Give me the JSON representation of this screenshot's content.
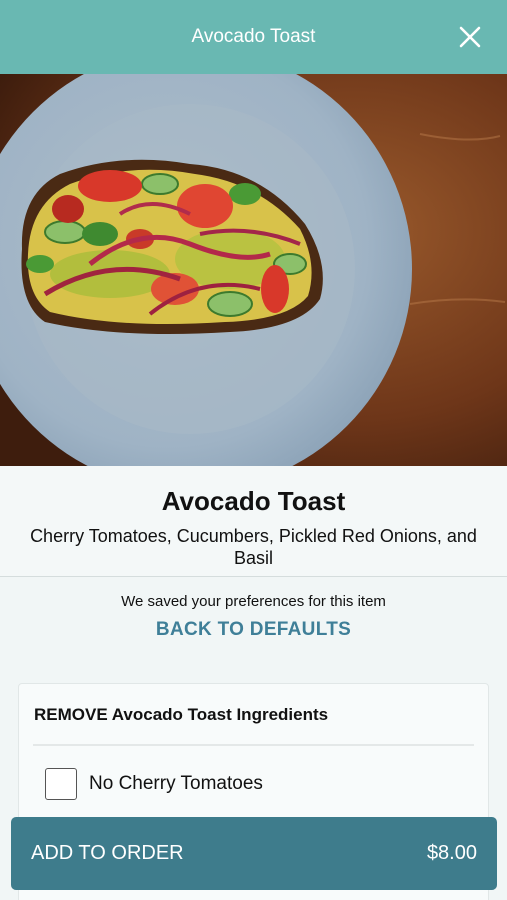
{
  "header": {
    "title": "Avocado Toast",
    "close_icon": "close-icon"
  },
  "item": {
    "title": "Avocado Toast",
    "description": "Cherry Tomatoes, Cucumbers, Pickled Red Onions, and Basil"
  },
  "preferences": {
    "note": "We saved your preferences for this item",
    "defaults_link": "BACK TO DEFAULTS"
  },
  "ingredients": {
    "heading": "REMOVE Avocado Toast Ingredients",
    "options": [
      {
        "label": "No Cherry Tomatoes",
        "checked": false
      }
    ]
  },
  "order": {
    "label": "ADD TO ORDER",
    "price": "$8.00"
  },
  "colors": {
    "header": "#69b8b2",
    "accent": "#3e7c8c",
    "link": "#3f7f98"
  }
}
